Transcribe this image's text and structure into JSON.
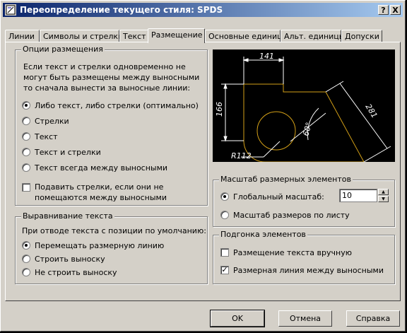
{
  "window": {
    "title": "Переопределение текущего стиля: SPDS",
    "help_label": "?",
    "close_label": "X"
  },
  "tabs": [
    {
      "label": "Линии"
    },
    {
      "label": "Символы и стрелки"
    },
    {
      "label": "Текст"
    },
    {
      "label": "Размещение"
    },
    {
      "label": "Основные единицы"
    },
    {
      "label": "Альт. единицы"
    },
    {
      "label": "Допуски"
    }
  ],
  "active_tab": "Размещение",
  "fit_options": {
    "legend": "Опции размещения",
    "description": [
      "Если текст и стрелки одновременно не",
      "могут быть размещены между выносными",
      "то сначала вынести за выносные линии:"
    ],
    "options": [
      {
        "label": "Либо текст, либо стрелки (оптимально)",
        "selected": true
      },
      {
        "label": "Стрелки",
        "selected": false
      },
      {
        "label": "Текст",
        "selected": false
      },
      {
        "label": "Текст и стрелки",
        "selected": false
      },
      {
        "label": "Текст всегда между выносными",
        "selected": false
      }
    ],
    "suppress_checkbox": {
      "lines": [
        "Подавить стрелки, если они не",
        "помещаются между выносными"
      ],
      "checked": false
    }
  },
  "text_placement": {
    "legend": "Выравнивание текста",
    "description": "При отводе текста с позиции по умолчанию:",
    "options": [
      {
        "label": "Перемещать размерную линию",
        "selected": true
      },
      {
        "label": "Строить выноску",
        "selected": false
      },
      {
        "label": "Не строить выноску",
        "selected": false
      }
    ]
  },
  "preview": {
    "labels": {
      "top": "141",
      "left": "166",
      "diag": "281",
      "angle": "60°",
      "radius": "R112"
    },
    "line_color": "#d4a017",
    "text_color": "#ffffff"
  },
  "scale": {
    "legend": "Масштаб размерных элементов",
    "global_label": "Глобальный масштаб:",
    "global_selected": true,
    "global_value": "10",
    "layout_label": "Масштаб размеров по листу",
    "layout_selected": false
  },
  "fine_tuning": {
    "legend": "Подгонка элементов",
    "manual_label": "Размещение текста вручную",
    "manual_checked": false,
    "dimline_label": "Размерная линия между выносными",
    "dimline_checked": true
  },
  "buttons": {
    "ok": "OK",
    "cancel": "Отмена",
    "help": "Справка"
  }
}
